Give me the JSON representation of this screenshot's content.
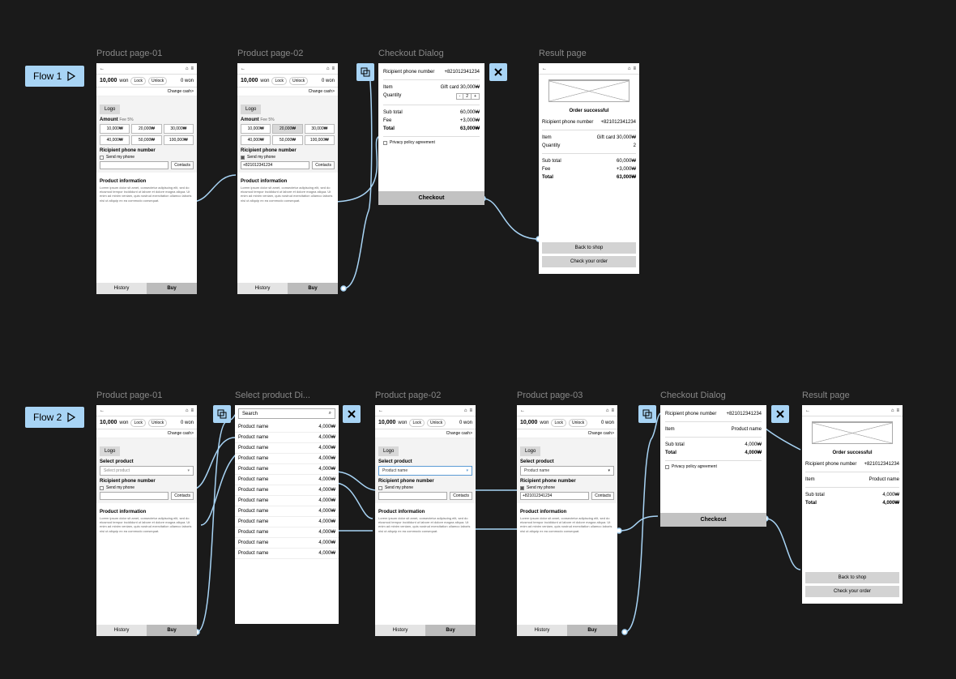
{
  "flows": {
    "f1": "Flow 1",
    "f2": "Flow 2"
  },
  "titles": {
    "pp01": "Product page-01",
    "pp02": "Product page-02",
    "pp03": "Product page-03",
    "checkout": "Checkout Dialog",
    "result": "Result page",
    "selectProd": "Select product Di..."
  },
  "common": {
    "balance": "10,000",
    "currency": "won",
    "lock": "Lock",
    "unlock": "Unlock",
    "zeroWon": "0 won",
    "chargeCash": "Change cash>",
    "logo": "Logo",
    "amount": "Amount",
    "fee": "Fee 5%",
    "ricipientPhone": "Ricipient phone number",
    "sendMyPhone": "Send my phone",
    "contacts": "Contacts",
    "productInfo": "Product information",
    "lorem": "Lorem ipsum dolor sit amet, consectetur adipiscing elit, sed do eiusmod tempor incididunt ut labore et dolore magna aliqua. Ut enim ad minim veniam, quis nostrud exercitation ullamco laboris nisi ut aliquip ex ea commodo consequat.",
    "history": "History",
    "buy": "Buy",
    "selectProduct": "Select product",
    "selectPlaceholder": "Select product",
    "productName": "Product name",
    "phoneValue": "+821012341234",
    "search": "Search"
  },
  "amounts1": [
    "10,000₩",
    "20,000₩",
    "30,000₩",
    "40,000₩",
    "50,000₩",
    "100,000₩"
  ],
  "checkout": {
    "item": "Item",
    "giftCard": "Gift card 30,000₩",
    "quantity": "Quantity",
    "qtyVal": "2",
    "subtotal": "Sub total",
    "subtotalVal": "60,000₩",
    "fee": "Fee",
    "feeVal": "+3,000₩",
    "total": "Total",
    "totalVal": "63,000₩",
    "privacy": "Privacy policy agreement",
    "checkout": "Checkout",
    "subtotal2": "4,000₩",
    "total2": "4,000₩"
  },
  "result": {
    "orderSuccess": "Order successful",
    "backToShop": "Back to shop",
    "checkOrder": "Check your order"
  },
  "productList": {
    "name": "Product name",
    "price": "4,000₩"
  }
}
